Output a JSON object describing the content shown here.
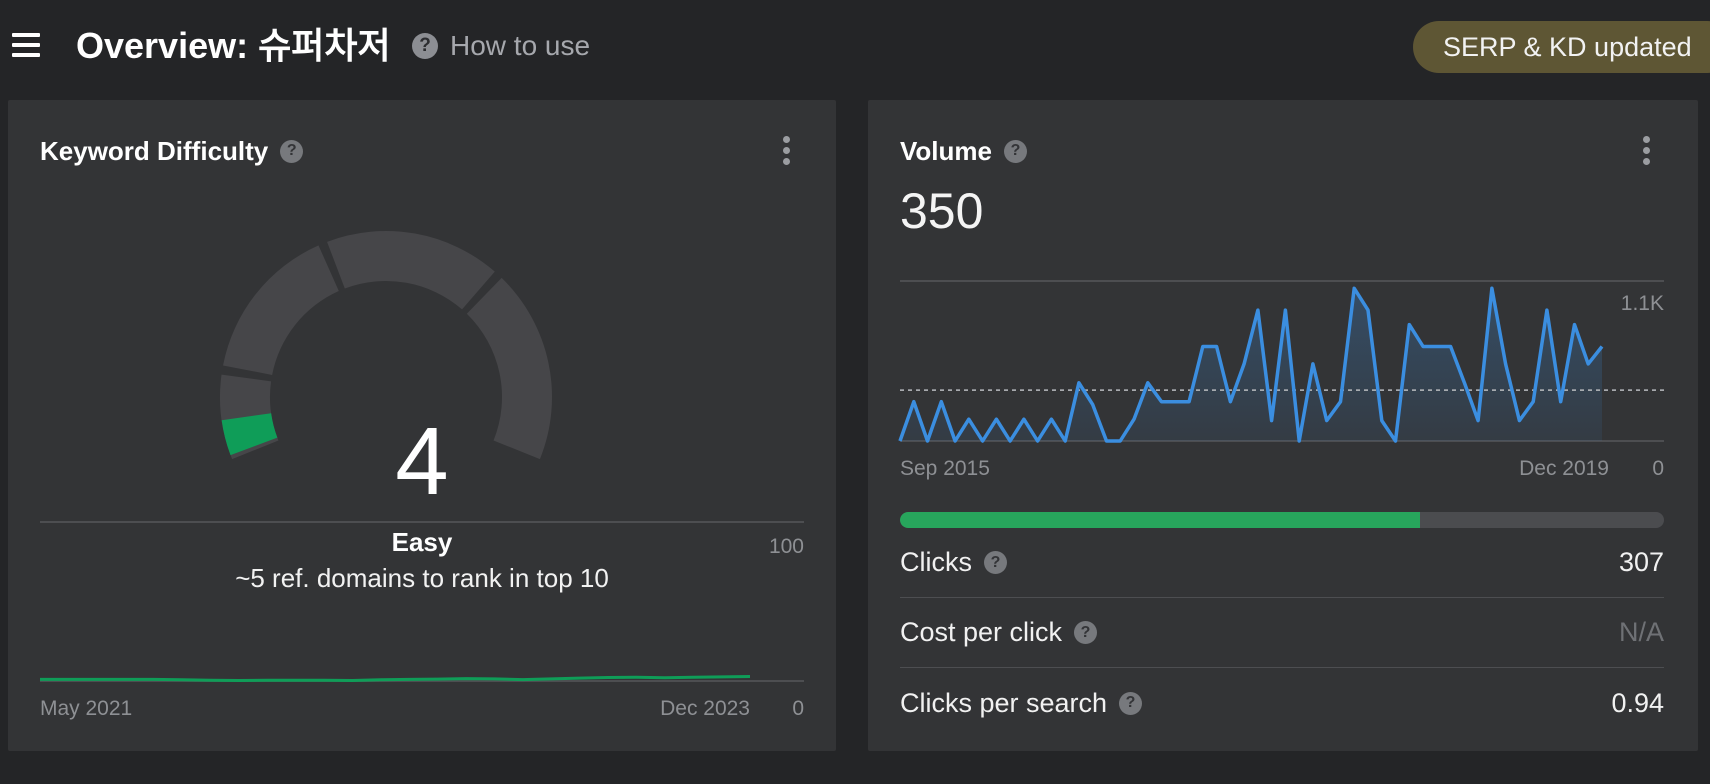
{
  "header": {
    "title": "Overview: 슈퍼차저",
    "help_label": "How to use",
    "badge": "SERP & KD updated"
  },
  "kd_card": {
    "title": "Keyword Difficulty",
    "value": "4",
    "value_number": 4,
    "label": "Easy",
    "description": "~5 ref. domains to rank in top 10",
    "history": {
      "start_label": "May 2021",
      "end_label": "Dec 2023",
      "y_max_label": "100",
      "y_min_label": "0",
      "values": [
        1,
        1,
        1,
        1,
        1,
        0.8,
        0.5,
        0.3,
        0.5,
        0.5,
        0.5,
        0.3,
        0.8,
        1,
        1.2,
        1.5,
        1.3,
        0.9,
        1.3,
        1.8,
        2.2,
        2.4,
        2,
        2.3,
        2.6,
        2.8
      ]
    },
    "colors": {
      "accent": "#0f9d58",
      "track": "#464649"
    }
  },
  "volume_card": {
    "title": "Volume",
    "value": "350",
    "chart": {
      "start_label": "Sep 2015",
      "end_label": "Dec 2019",
      "y_max_label": "1.1K",
      "y_min_label": "0",
      "average_line": 350,
      "values": [
        0,
        270,
        0,
        270,
        0,
        150,
        0,
        150,
        0,
        150,
        0,
        150,
        0,
        400,
        250,
        0,
        0,
        150,
        400,
        270,
        270,
        270,
        650,
        650,
        270,
        530,
        900,
        140,
        900,
        0,
        530,
        140,
        270,
        1050,
        900,
        140,
        0,
        800,
        650,
        650,
        650,
        400,
        140,
        1050,
        530,
        140,
        270,
        900,
        270,
        800,
        530,
        650
      ],
      "color": "#3b8ee0"
    },
    "clicks_share": 0.68,
    "metrics": [
      {
        "name": "Clicks",
        "value": "307",
        "muted": false
      },
      {
        "name": "Cost per click",
        "value": "N/A",
        "muted": true
      },
      {
        "name": "Clicks per search",
        "value": "0.94",
        "muted": false
      }
    ]
  }
}
